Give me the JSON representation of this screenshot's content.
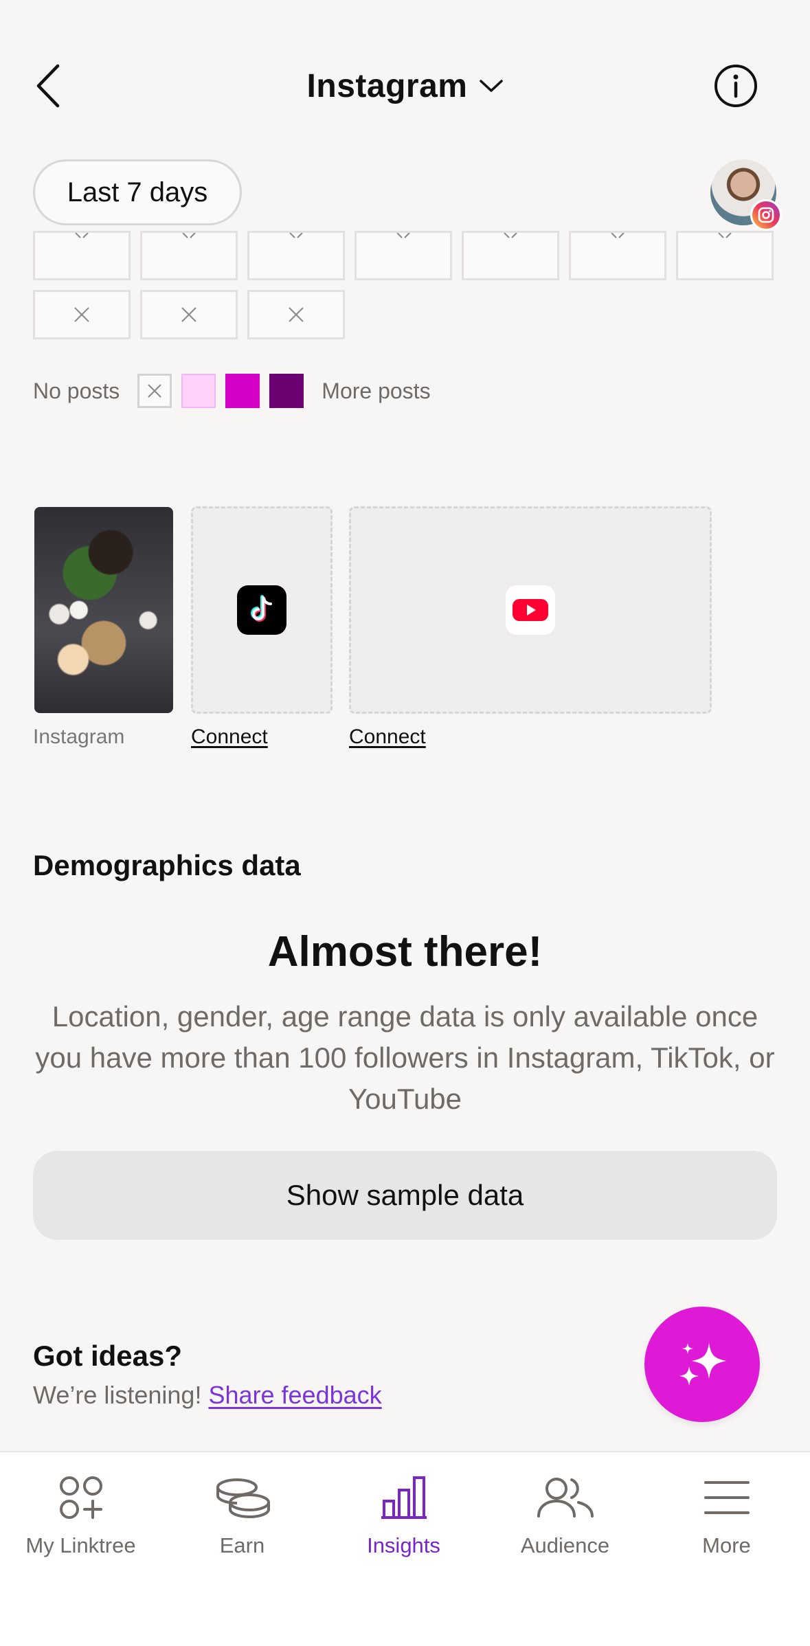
{
  "header": {
    "title": "Instagram",
    "date_range": "Last 7 days"
  },
  "legend": {
    "no_posts": "No posts",
    "more_posts": "More posts",
    "colors": [
      "#ffd1fb",
      "#d400c8",
      "#6b0072"
    ]
  },
  "posts": {
    "instagram_label": "Instagram",
    "tiktok_action": "Connect",
    "youtube_action": "Connect"
  },
  "demographics": {
    "heading": "Demographics data",
    "title": "Almost there!",
    "body": "Location, gender, age range data is only available once you have more than 100 followers in Instagram, TikTok, or YouTube",
    "button": "Show sample data"
  },
  "feedback": {
    "heading": "Got ideas?",
    "text": "We’re listening!",
    "link": "Share feedback"
  },
  "nav": {
    "items": [
      {
        "label": "My Linktree",
        "icon": "linktree-icon"
      },
      {
        "label": "Earn",
        "icon": "coins-icon"
      },
      {
        "label": "Insights",
        "icon": "bar-chart-icon",
        "active": true
      },
      {
        "label": "Audience",
        "icon": "people-icon"
      },
      {
        "label": "More",
        "icon": "menu-icon"
      }
    ]
  },
  "accent_color": "#7a24c9",
  "fab_color": "#df1ad6"
}
